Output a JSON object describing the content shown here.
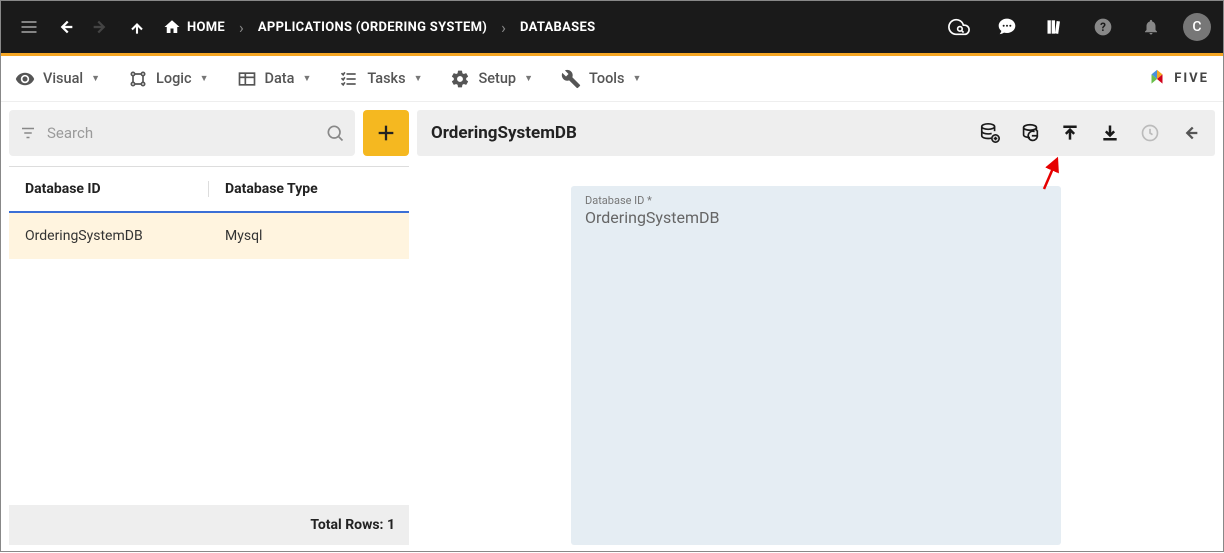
{
  "topbar": {
    "breadcrumbs": [
      {
        "label": "HOME"
      },
      {
        "label": "APPLICATIONS (ORDERING SYSTEM)"
      },
      {
        "label": "DATABASES"
      }
    ],
    "avatar_letter": "C"
  },
  "menubar": {
    "items": [
      {
        "label": "Visual"
      },
      {
        "label": "Logic"
      },
      {
        "label": "Data"
      },
      {
        "label": "Tasks"
      },
      {
        "label": "Setup"
      },
      {
        "label": "Tools"
      }
    ],
    "logo_text": "FIVE"
  },
  "search": {
    "placeholder": "Search"
  },
  "table": {
    "headers": [
      "Database ID",
      "Database Type"
    ],
    "rows": [
      {
        "id": "OrderingSystemDB",
        "type": "Mysql"
      }
    ],
    "footer_label": "Total Rows: 1"
  },
  "detail": {
    "title": "OrderingSystemDB",
    "field_label": "Database ID *",
    "field_value": "OrderingSystemDB"
  }
}
